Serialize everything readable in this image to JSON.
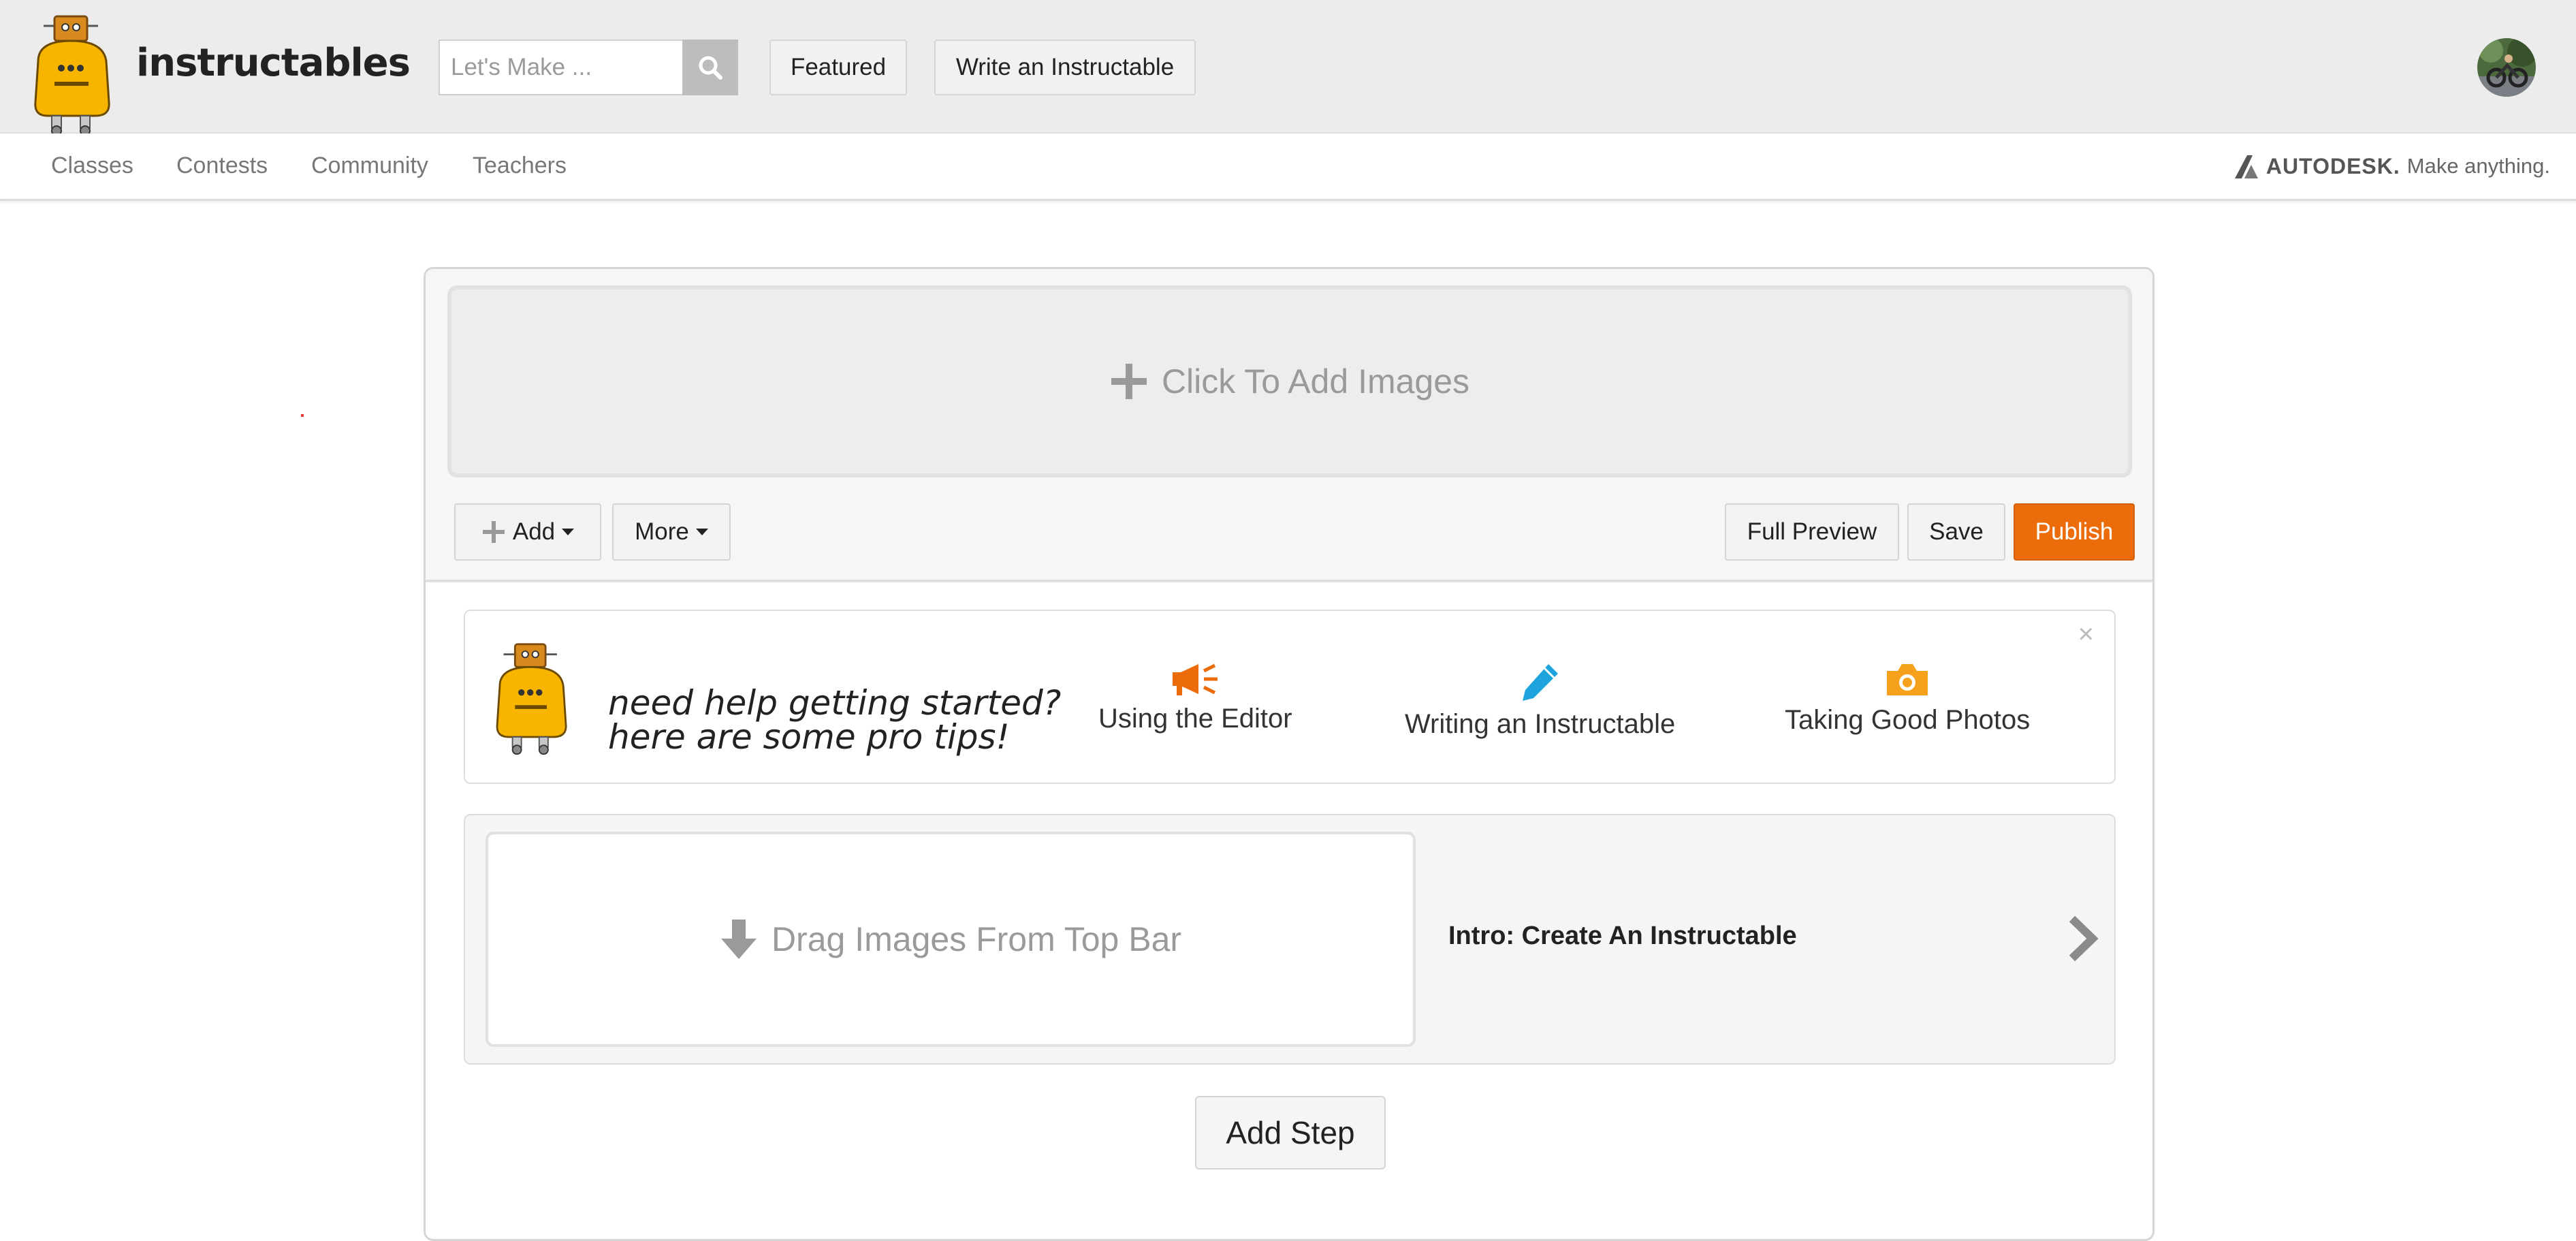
{
  "header": {
    "brand": "instructables",
    "search": {
      "placeholder": "Let's Make ...",
      "value": ""
    },
    "buttons": {
      "featured": "Featured",
      "write": "Write an Instructable"
    }
  },
  "subnav": {
    "items": [
      "Classes",
      "Contests",
      "Community",
      "Teachers"
    ],
    "autodesk": {
      "name": "AUTODESK.",
      "tagline": "Make anything."
    }
  },
  "editor": {
    "add_images": "Click To Add Images",
    "toolbar": {
      "add": "Add",
      "more": "More",
      "full_preview": "Full Preview",
      "save": "Save",
      "publish": "Publish"
    },
    "tips": {
      "line1": "need help getting started?",
      "line2": "here are some pro tips!",
      "links": [
        {
          "label": "Using the Editor",
          "icon": "megaphone-icon",
          "color": "#ec6c0b"
        },
        {
          "label": "Writing an Instructable",
          "icon": "pencil-icon",
          "color": "#1ea3dc"
        },
        {
          "label": "Taking Good Photos",
          "icon": "camera-icon",
          "color": "#f5a11c"
        }
      ],
      "close": "×"
    },
    "step": {
      "drop_label": "Drag Images From Top Bar",
      "title": "Intro: Create An Instructable"
    },
    "add_step": "Add Step"
  },
  "colors": {
    "accent": "#ec6c0b",
    "header_bg": "#ececec",
    "robot_yellow": "#f7b500"
  }
}
